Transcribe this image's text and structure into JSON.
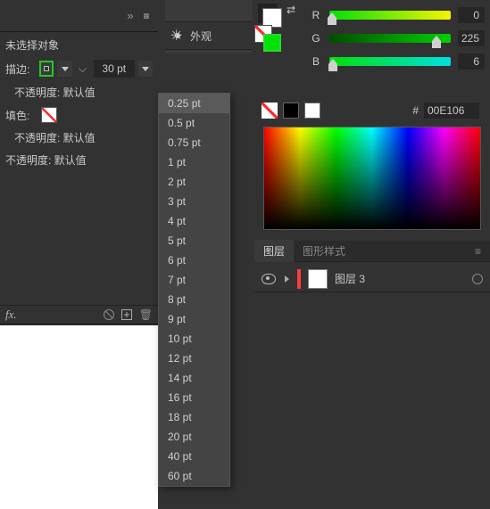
{
  "left": {
    "no_selection": "未选择对象",
    "stroke_label": "描边:",
    "stroke_value": "30 pt",
    "opacity_default": "不透明度: 默认值",
    "fill_label": "填色:",
    "fx_label": "fx."
  },
  "stroke_dropdown": {
    "items": [
      "0.25 pt",
      "0.5 pt",
      "0.75 pt",
      "1 pt",
      "2 pt",
      "3 pt",
      "4 pt",
      "5 pt",
      "6 pt",
      "7 pt",
      "8 pt",
      "9 pt",
      "10 pt",
      "12 pt",
      "14 pt",
      "16 pt",
      "18 pt",
      "20 pt",
      "40 pt",
      "60 pt"
    ],
    "selected": "0.25 pt"
  },
  "mid": {
    "appearance": "外观"
  },
  "color": {
    "r_label": "R",
    "r_value": "0",
    "g_label": "G",
    "g_value": "225",
    "b_label": "B",
    "b_value": "6",
    "hash": "#",
    "hex": "00E106"
  },
  "layers": {
    "tab_layers": "图层",
    "tab_styles": "图形样式",
    "menu": "≡",
    "row1_name": "图层 3"
  }
}
